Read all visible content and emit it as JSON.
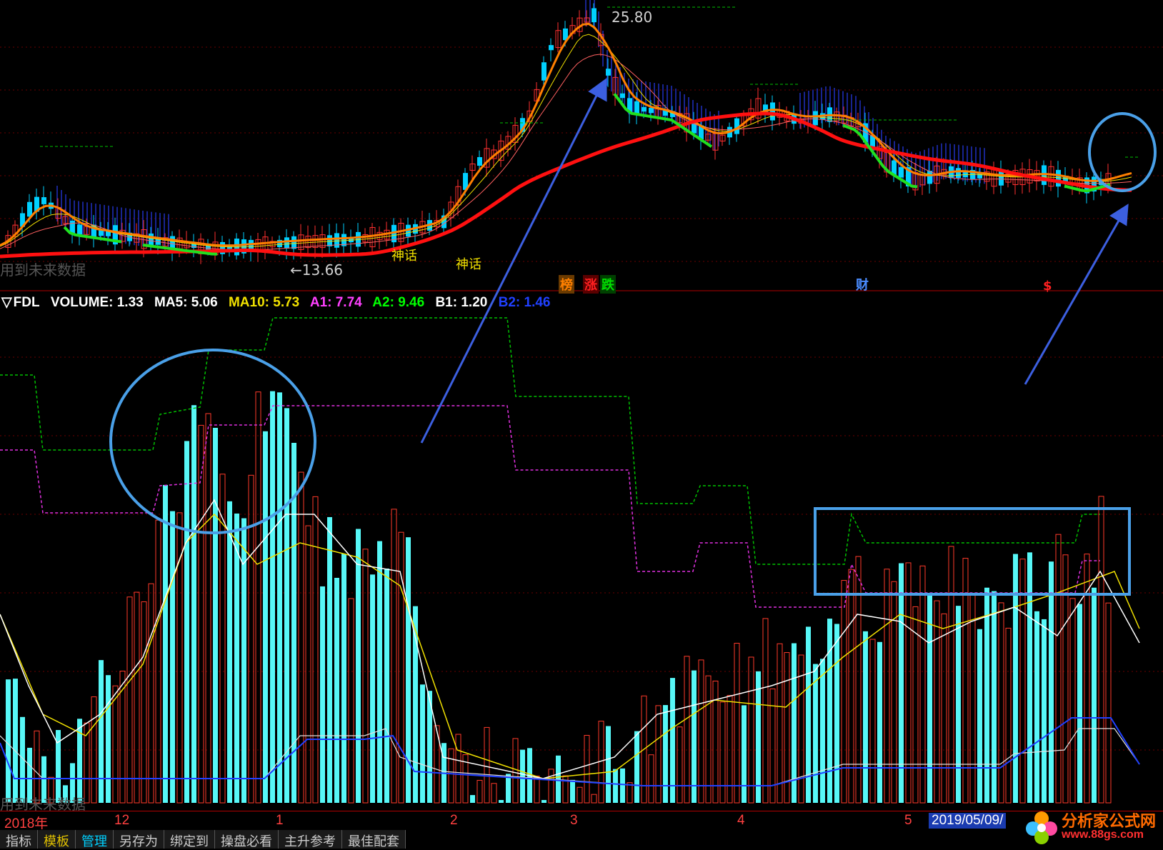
{
  "price_panel": {
    "high_label": "25.80",
    "low_label": "←13.66",
    "watermark_text": "用到未来数据",
    "signals": [
      "神话",
      "神话"
    ],
    "events": [
      {
        "text": "榜",
        "color": "#ff8000"
      },
      {
        "text": "涨",
        "color": "#ff2020"
      },
      {
        "text": "跌",
        "color": "#00e000"
      },
      {
        "text": "财",
        "color": "#4a8cff"
      },
      {
        "text": "$",
        "color": "#ff2020"
      }
    ]
  },
  "indicator": {
    "name": "FDL",
    "legend": [
      {
        "label": "VOLUME: 1.33",
        "color": "#ffffff"
      },
      {
        "label": "MA5: 5.06",
        "color": "#ffffff"
      },
      {
        "label": "MA10: 5.73",
        "color": "#f0e000"
      },
      {
        "label": "A1: 7.74",
        "color": "#ff40ff"
      },
      {
        "label": "A2: 9.46",
        "color": "#00ff00"
      },
      {
        "label": "B1: 1.20",
        "color": "#ffffff"
      },
      {
        "label": "B2: 1.46",
        "color": "#2040ff"
      }
    ],
    "watermark_text": "用到未来数据",
    "legend_prefix": "▽"
  },
  "time_axis": {
    "ticks": [
      "2018年",
      "12",
      "1",
      "2",
      "3",
      "4",
      "5"
    ],
    "current_date": "2019/05/09/"
  },
  "toolbar": {
    "tabs": [
      "指标",
      "模板",
      "管理",
      "另存为",
      "绑定到",
      "操盘必看",
      "主升参考",
      "最佳配套"
    ]
  },
  "watermark": {
    "title": "分析家公式网",
    "url": "www.88gs.com"
  },
  "colors": {
    "up_candle": "#ff3030",
    "down_candle": "#00d0ff",
    "volume_up": "#ff3a2a",
    "volume_down": "#57f7f7",
    "annotation": "#4aa0e8",
    "arrow": "#3c5fe0"
  }
}
